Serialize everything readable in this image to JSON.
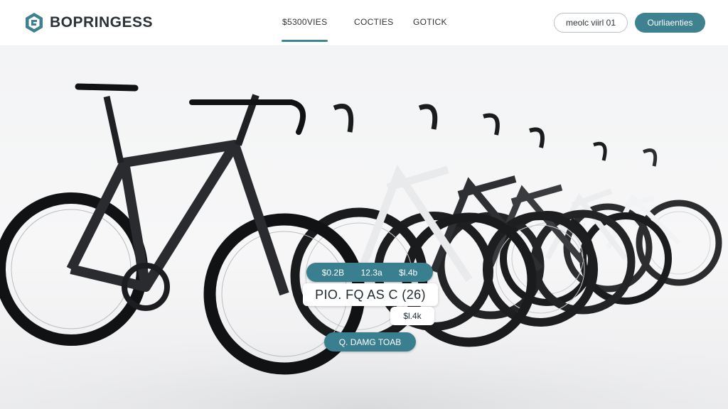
{
  "brand": {
    "name": "BOPRINGESS",
    "logo_icon": "hexagon-logo-icon",
    "accent": "#3e8191"
  },
  "nav": {
    "items": [
      {
        "label": "$5300VIES",
        "active": true
      },
      {
        "label": "COCTIES",
        "active": false
      },
      {
        "label": "GOTICK",
        "active": false
      }
    ]
  },
  "actions": {
    "outline_label": "meolc viirl 01",
    "solid_label": "Ourliaenties"
  },
  "hero": {
    "image": "road-bikes-lineup",
    "price_row": [
      "$0.2B",
      "12.3a",
      "$l.4b"
    ],
    "model_label": "PIO. FQ AS C (26)",
    "small_price": "$l.4k",
    "cta_label": "Q. DAMG TOAB"
  }
}
